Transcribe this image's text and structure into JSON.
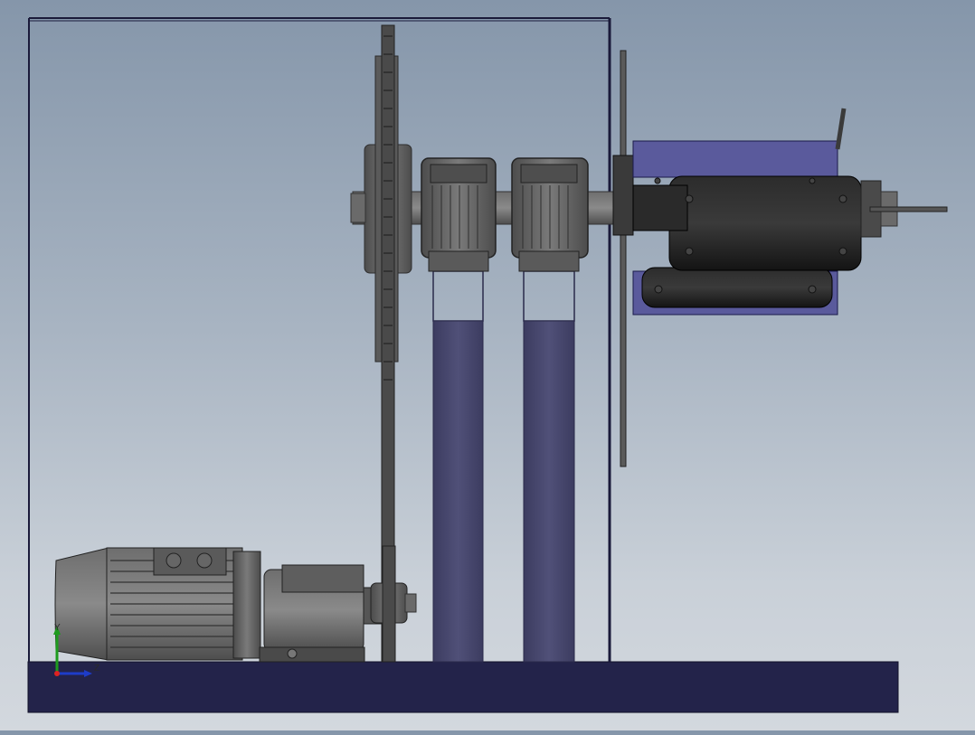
{
  "viewport": {
    "background_top": "#8596aa",
    "background_bottom": "#d3d8de",
    "triad": {
      "y_label": "Y",
      "z_label": "Z"
    }
  },
  "model": {
    "frame_color": "#23234a",
    "post_color": "#46466a",
    "tray_color": "#5a5a9c",
    "metal_color": "#5a5a5a",
    "dark_metal_color": "#1e1e1e"
  }
}
